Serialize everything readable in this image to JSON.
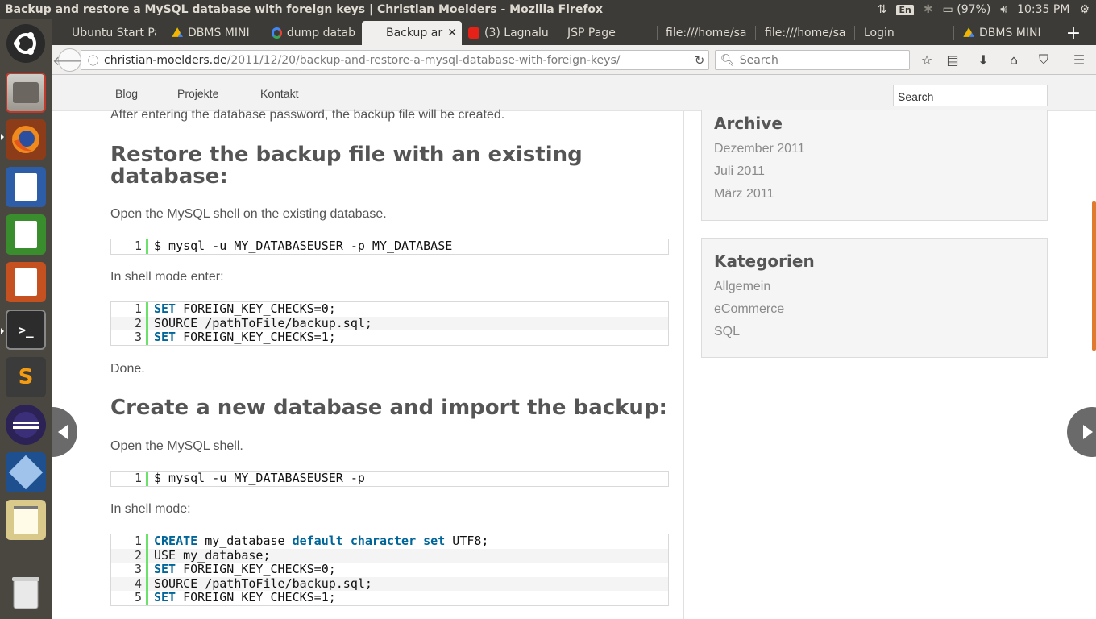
{
  "window": {
    "title": "Backup and restore a MySQL database with foreign keys | Christian Moelders - Mozilla Firefox"
  },
  "system": {
    "keyboard": "En",
    "battery": "(97%)",
    "time": "10:35 PM"
  },
  "tabs": [
    {
      "label": "Ubuntu Start Pa",
      "icon": "ubuntu-icon"
    },
    {
      "label": "DBMS MINI",
      "icon": "google-drive-icon"
    },
    {
      "label": "dump datab",
      "icon": "google-icon"
    },
    {
      "label": "Backup ar",
      "icon": "none",
      "active": true
    },
    {
      "label": "(3) Lagnalu",
      "icon": "youtube-icon"
    },
    {
      "label": "JSP Page",
      "icon": "none"
    },
    {
      "label": "file:///home/sa",
      "icon": "none"
    },
    {
      "label": "file:///home/sa",
      "icon": "none"
    },
    {
      "label": "Login",
      "icon": "none"
    },
    {
      "label": "DBMS MINI",
      "icon": "google-drive-icon"
    }
  ],
  "newtab_label": "+",
  "nav": {
    "url_domain": "christian-moelders.de",
    "url_path": "/2011/12/20/backup-and-restore-a-mysql-database-with-foreign-keys/",
    "search_placeholder": "Search"
  },
  "site": {
    "nav_links": [
      "Blog",
      "Projekte",
      "Kontakt"
    ],
    "search_value": "Search"
  },
  "article": {
    "p_after_password": "After entering the database password, the backup file will be created.",
    "h_restore": "Restore the backup file with an existing database:",
    "h_restore_line1": "Restore the backup file with an existing",
    "h_restore_line2": "database:",
    "p_open_existing": "Open the MySQL shell on the existing database.",
    "code1": [
      {
        "n": "1",
        "pre": "",
        "kw": "",
        "post": "$ mysql -u MY_DATABASEUSER -p MY_DATABASE"
      }
    ],
    "p_shell_enter": "In shell mode enter:",
    "code2": [
      {
        "n": "1",
        "pre": "",
        "kw": "SET",
        "post": " FOREIGN_KEY_CHECKS=0;"
      },
      {
        "n": "2",
        "pre": "",
        "kw": "",
        "post": "SOURCE /pathToFile/backup.sql;"
      },
      {
        "n": "3",
        "pre": "",
        "kw": "SET",
        "post": " FOREIGN_KEY_CHECKS=1;"
      }
    ],
    "p_done": "Done.",
    "h_create": "Create a new database and import the backup:",
    "p_open_shell": "Open the MySQL shell.",
    "code3": [
      {
        "n": "1",
        "pre": "",
        "kw": "",
        "post": "$ mysql -u MY_DATABASEUSER -p"
      }
    ],
    "p_shell_mode": "In shell mode:",
    "code4": [
      {
        "n": "1",
        "line": "CREATE my_database default character set UTF8;"
      },
      {
        "n": "2",
        "line": "USE my_database;"
      },
      {
        "n": "3",
        "line": "SET FOREIGN_KEY_CHECKS=0;"
      },
      {
        "n": "4",
        "line": "SOURCE /pathToFile/backup.sql;"
      },
      {
        "n": "5",
        "line": "SET FOREIGN_KEY_CHECKS=1;"
      }
    ]
  },
  "sidebar": {
    "archive_title": "Archive",
    "archive_links": [
      "Dezember 2011",
      "Juli 2011",
      "März 2011"
    ],
    "categories_title": "Kategorien",
    "categories_links": [
      "Allgemein",
      "eCommerce",
      "SQL"
    ]
  },
  "colors": {
    "accent_scroll": "#e07a2e",
    "code_keyword": "#006699",
    "code_gutter": "#6ce26c"
  }
}
